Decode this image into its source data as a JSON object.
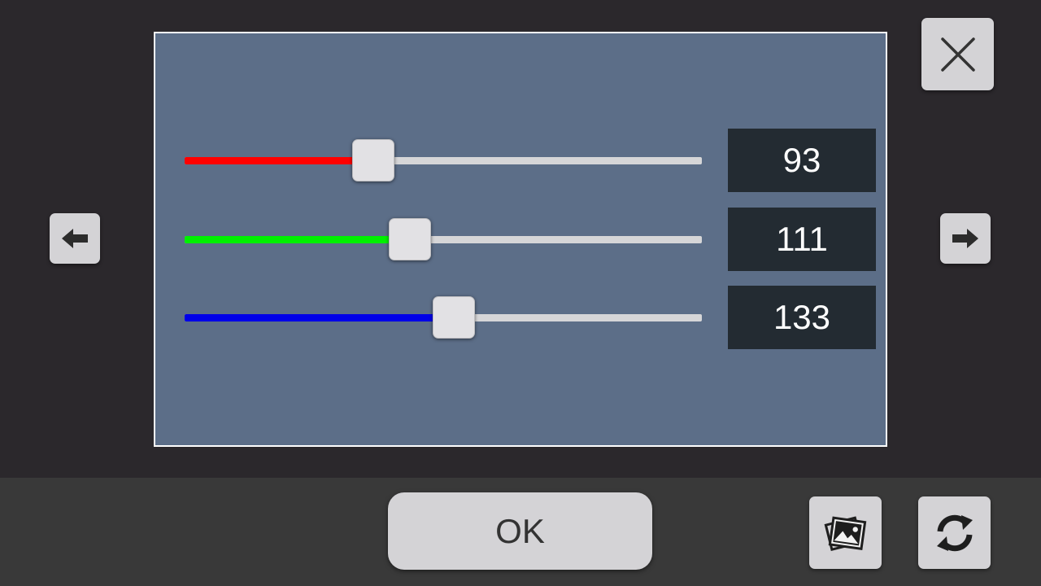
{
  "colors": {
    "background": "#2b282c",
    "bottom_bar": "#393939",
    "preview": "#5c6e88",
    "button": "#d4d3d6",
    "value_box": "#232b32"
  },
  "sliders": [
    {
      "channel": "red",
      "value": "93",
      "fraction": 0.365,
      "fill_color": "#ff0000"
    },
    {
      "channel": "green",
      "value": "111",
      "fraction": 0.435,
      "fill_color": "#00f000"
    },
    {
      "channel": "blue",
      "value": "133",
      "fraction": 0.52,
      "fill_color": "#0000e8"
    }
  ],
  "buttons": {
    "ok_label": "OK",
    "close_icon": "close-icon",
    "prev_icon": "arrow-left-icon",
    "next_icon": "arrow-right-icon",
    "gallery_icon": "gallery-icon",
    "refresh_icon": "refresh-icon"
  }
}
